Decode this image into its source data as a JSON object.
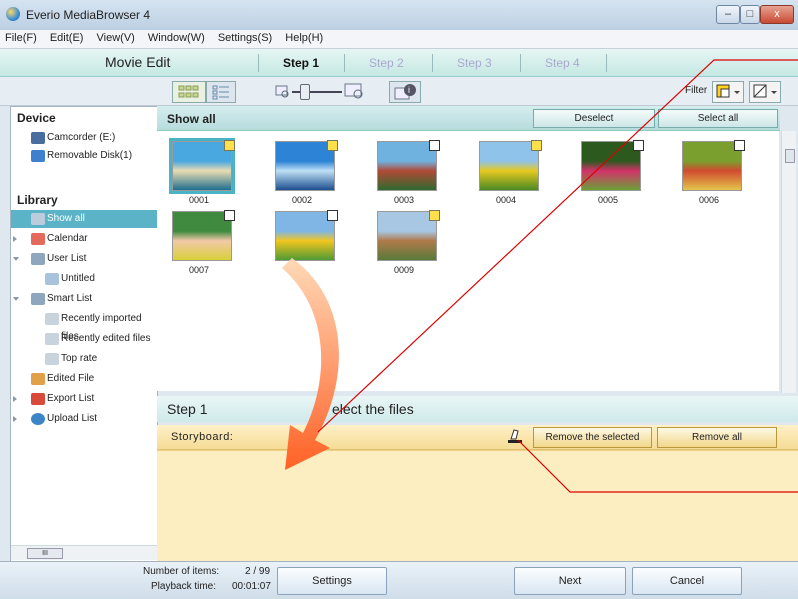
{
  "window": {
    "title": "Everio MediaBrowser 4",
    "min": "–",
    "max": "□",
    "close": "x"
  },
  "menu": [
    "File(F)",
    "Edit(E)",
    "View(V)",
    "Window(W)",
    "Settings(S)",
    "Help(H)"
  ],
  "mode": {
    "title": "Movie Edit",
    "steps": [
      "Step 1",
      "Step 2",
      "Step 3",
      "Step 4"
    ]
  },
  "toolbar": {
    "filter_label": "Filter"
  },
  "left": {
    "device_header": "Device",
    "devices": [
      "Camcorder (E:)",
      "Removable Disk(1)"
    ],
    "library_header": "Library",
    "items": [
      "Show all",
      "Calendar",
      "User List",
      "Untitled",
      "Smart List",
      "Recently imported files",
      "Recently edited files",
      "Top rate",
      "Edited File",
      "Export List",
      "Upload List"
    ],
    "scroll_text": "III"
  },
  "content": {
    "title": "Show all",
    "deselect": "Deselect",
    "select_all": "Select all",
    "thumbs": [
      {
        "num": "0001",
        "flag": "video",
        "colors": [
          "#4aa8e0",
          "#e8dcb2",
          "#1f6f8f"
        ]
      },
      {
        "num": "0002",
        "flag": "video",
        "colors": [
          "#2d84d6",
          "#bfe0f5",
          "#1d4f8f"
        ]
      },
      {
        "num": "0003",
        "flag": "still",
        "colors": [
          "#6fb2e0",
          "#b04a36",
          "#2f6a2f"
        ]
      },
      {
        "num": "0004",
        "flag": "video",
        "colors": [
          "#8fc3ea",
          "#e6c81f",
          "#4a8a24"
        ]
      },
      {
        "num": "0005",
        "flag": "still",
        "colors": [
          "#2c5a1e",
          "#d3326a",
          "#6aa037"
        ]
      },
      {
        "num": "0006",
        "flag": "still",
        "colors": [
          "#7a9f2e",
          "#d04b2e",
          "#e3c44a"
        ]
      },
      {
        "num": "0007",
        "flag": "still",
        "colors": [
          "#3f8a3f",
          "#f2c9a8",
          "#d9cf3a"
        ]
      },
      {
        "num": "",
        "flag": "still",
        "colors": [
          "#7fb6e6",
          "#f2c61f",
          "#4f9a34"
        ]
      },
      {
        "num": "0009",
        "flag": "video",
        "colors": [
          "#a8c7e3",
          "#b07a4a",
          "#587a3a"
        ]
      }
    ]
  },
  "step": {
    "label": "Step 1",
    "instruction": "elect the files"
  },
  "storyboard": {
    "label": "Storyboard:",
    "remove_selected": "Remove the selected",
    "remove_all": "Remove all"
  },
  "status": {
    "items_label": "Number of items:",
    "items_value": "2 / 99",
    "time_label": "Playback time:",
    "time_value": "00:01:07",
    "settings": "Settings",
    "next": "Next",
    "cancel": "Cancel"
  }
}
